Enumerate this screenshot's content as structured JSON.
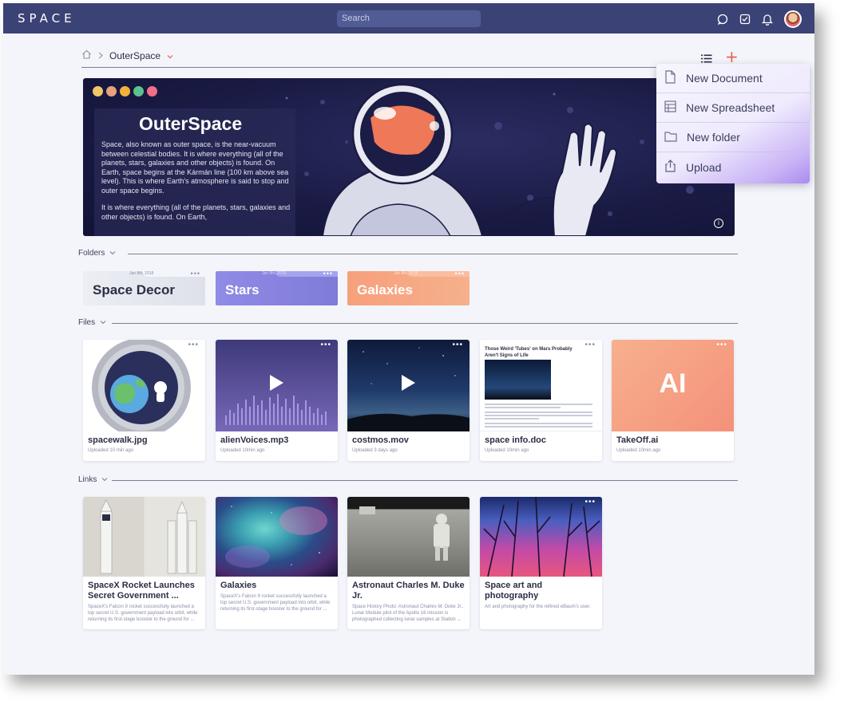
{
  "app": {
    "logo": "SPACE"
  },
  "search": {
    "placeholder": "Search"
  },
  "breadcrumb": {
    "current": "OuterSpace"
  },
  "hero": {
    "title": "OuterSpace",
    "paragraph1": "Space, also known as outer space, is the near-vacuum between celestial bodies. It is where everything (all of the planets, stars, galaxies and other objects) is found. On Earth, space begins at the Kármán line (100 km above sea level). This is where Earth's atmosphere is said to stop and outer space begins.",
    "paragraph2": "It is where everything (all of the planets, stars, galaxies and other objects) is found. On Earth,"
  },
  "menu": {
    "items": [
      {
        "label": "New Document",
        "icon": "document-icon"
      },
      {
        "label": "New Spreadsheet",
        "icon": "spreadsheet-icon"
      },
      {
        "label": "New folder",
        "icon": "folder-icon"
      },
      {
        "label": "Upload",
        "icon": "upload-icon"
      }
    ]
  },
  "sections": {
    "folders": "Folders",
    "files": "Files",
    "links": "Links"
  },
  "folders": [
    {
      "name": "Space Decor",
      "date": "Jan 8th, 2018",
      "color": "#e6e8f0"
    },
    {
      "name": "Stars",
      "date": "Jan 8th, 2018",
      "color": "#8b87e2"
    },
    {
      "name": "Galaxies",
      "date": "Jan 8th, 2018",
      "color": "#f7a07c"
    }
  ],
  "files": [
    {
      "name": "spacewalk.jpg",
      "meta": "Uploaded 10 min ago"
    },
    {
      "name": "alienVoices.mp3",
      "meta": "Uploaded 10min ago"
    },
    {
      "name": "costmos.mov",
      "meta": "Uploaded 3 days ago"
    },
    {
      "name": "space info.doc",
      "meta": "Uploaded 10min ago",
      "doc_heading": "Those Weird 'Tubes' on Mars Probably Aren't Signs of Life"
    },
    {
      "name": "TakeOff.ai",
      "meta": "Uploaded 10min ago",
      "badge": "AI"
    }
  ],
  "links": [
    {
      "title": "SpaceX Rocket Launches Secret Government ...",
      "desc": "SpaceX's Falcon 9 rocket successfully launched a top secret U.S. government payload into orbit, while returning its first-stage booster to the ground for ..."
    },
    {
      "title": "Galaxies",
      "desc": "SpaceX's Falcon 9 rocket successfully launched a top secret U.S. government payload into orbit, while returning its first-stage booster to the ground for ..."
    },
    {
      "title": "Astronaut Charles M. Duke Jr.",
      "desc": "Space History Photo: Astronaut Charles M. Duke Jr., Lunar Module pilot of the Apollo 16 mission is photographed collecting lunar samples at Station ..."
    },
    {
      "title": "Space art and photography",
      "desc": "Art and photography for the refined eBaum's user."
    }
  ]
}
